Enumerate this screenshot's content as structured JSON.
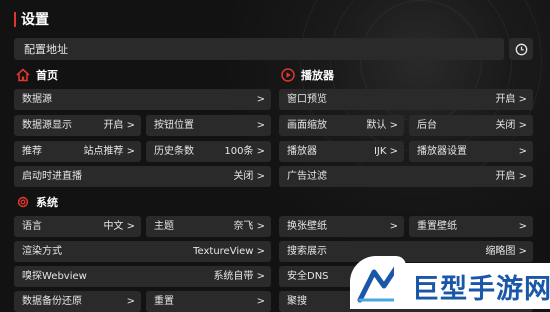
{
  "header": {
    "title": "设置"
  },
  "config_address": {
    "label": "配置地址"
  },
  "sections": {
    "home": "首页",
    "player": "播放器",
    "system": "系统"
  },
  "rows": {
    "datasource": {
      "label": "数据源",
      "value": ">"
    },
    "window_preview": {
      "label": "窗口预览",
      "value": "开启 >"
    },
    "datasource_display": {
      "label": "数据源显示",
      "value": "开启 >"
    },
    "button_position": {
      "label": "按钮位置",
      "value": ">"
    },
    "picture_scale": {
      "label": "画面缩放",
      "value": "默认 >"
    },
    "background": {
      "label": "后台",
      "value": "关闭 >"
    },
    "recommend": {
      "label": "推荐",
      "value": "站点推荐 >"
    },
    "history": {
      "label": "历史条数",
      "value": "100条 >"
    },
    "player": {
      "label": "播放器",
      "value": "IJK >"
    },
    "player_settings": {
      "label": "播放器设置",
      "value": ">"
    },
    "timeshift": {
      "label": "启动时进直播",
      "value": "关闭 >"
    },
    "ad_filter": {
      "label": "广告过滤",
      "value": "开启 >"
    },
    "language": {
      "label": "语言",
      "value": "中文 >"
    },
    "theme": {
      "label": "主题",
      "value": "奈飞 >"
    },
    "change_wallpaper": {
      "label": "换张壁纸",
      "value": ">"
    },
    "reset_wallpaper": {
      "label": "重置壁纸",
      "value": ">"
    },
    "render_mode": {
      "label": "渲染方式",
      "value": "TextureView >"
    },
    "search_display": {
      "label": "搜索展示",
      "value": "缩略图 >"
    },
    "sniff_webview": {
      "label": "嗅探Webview",
      "value": "系统自带 >"
    },
    "secure_dns": {
      "label": "安全DNS",
      "value": ""
    },
    "backup_restore": {
      "label": "数据备份还原",
      "value": ">"
    },
    "reset": {
      "label": "重置",
      "value": ">"
    },
    "aggregate": {
      "label": "聚搜",
      "value": ""
    }
  },
  "watermark": {
    "text": "巨型手游网"
  },
  "colors": {
    "accent": "#e0362d",
    "row_bg": "#2a2a2a",
    "background": "#121212",
    "watermark_blue": "#1a57a8"
  }
}
